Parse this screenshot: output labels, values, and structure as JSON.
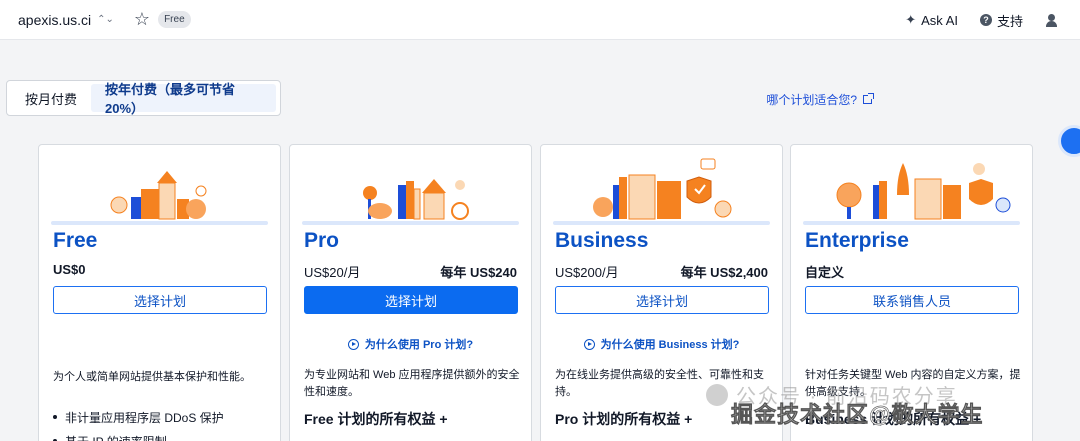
{
  "topbar": {
    "site": "apexis.us.ci",
    "plan_badge": "Free",
    "ask_ai": "Ask AI",
    "support": "支持"
  },
  "billing": {
    "monthly": "按月付费",
    "yearly": "按年付费（最多可节省 20%）",
    "which_plan": "哪个计划适合您?"
  },
  "plans": [
    {
      "name": "Free",
      "price": "US$0",
      "cta": "选择计划",
      "desc": "为个人或简单网站提供基本保护和性能。",
      "features": [
        "非计量应用程序层 DDoS 保护",
        "基于 IP 的速率限制"
      ]
    },
    {
      "name": "Pro",
      "price": "US$20/月",
      "annual": "每年 US$240",
      "cta": "选择计划",
      "why": "为什么使用 Pro 计划?",
      "desc": "为专业网站和 Web 应用程序提供额外的安全性和速度。",
      "benefits": "Free 计划的所有权益 +"
    },
    {
      "name": "Business",
      "price": "US$200/月",
      "annual": "每年 US$2,400",
      "cta": "选择计划",
      "why": "为什么使用 Business 计划?",
      "desc": "为在线业务提供高级的安全性、可靠性和支持。",
      "benefits": "Pro 计划的所有权益 +"
    },
    {
      "name": "Enterprise",
      "price": "自定义",
      "cta": "联系销售人员",
      "desc": "针对任务关键型 Web 内容的自定义方案，提供高级支持。",
      "benefits": "Business 计划的所有权益 +"
    }
  ],
  "watermark": {
    "line1": "公众号 · 前沿码农分享",
    "line2": "掘金技术社区@敬大学生"
  }
}
